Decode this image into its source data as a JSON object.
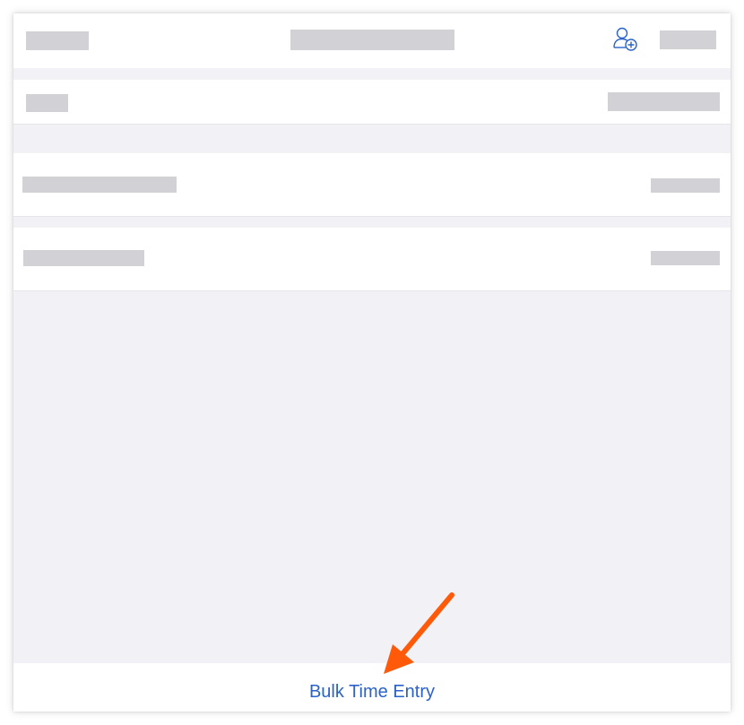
{
  "nav": {
    "left_placeholder": "",
    "title_placeholder": "",
    "right_placeholder": "",
    "add_user_icon": "person-plus-icon",
    "accent": "#2a62c9"
  },
  "rows": [
    {
      "label_placeholder": "",
      "value_placeholder": ""
    },
    {
      "label_placeholder": "",
      "value_placeholder": ""
    },
    {
      "label_placeholder": "",
      "value_placeholder": ""
    }
  ],
  "bottom_bar": {
    "button_label": "Bulk Time Entry"
  },
  "annotation": {
    "arrow_color": "#ff5a0a",
    "arrow_icon": "arrow-pointer-icon"
  },
  "colors": {
    "placeholder": "#d1d1d6",
    "background": "#f2f2f6",
    "surface": "#ffffff"
  }
}
